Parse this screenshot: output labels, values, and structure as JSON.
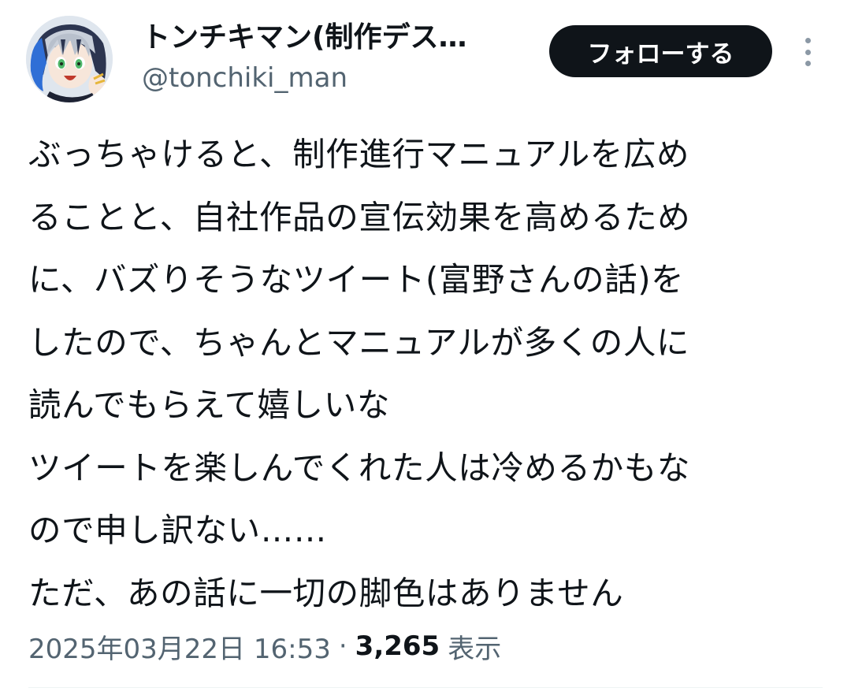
{
  "author": {
    "display_name": "トンチキマン(制作デス…",
    "handle": "@tonchiki_man"
  },
  "actions": {
    "follow_label": "フォローする"
  },
  "tweet": {
    "lines": [
      "ぶっちゃけると、制作進行マニュアルを広め",
      "ることと、自社作品の宣伝効果を高めるため",
      "に、バズりそうなツイート(富野さんの話)を",
      "したので、ちゃんとマニュアルが多くの人に",
      "読んでもらえて嬉しいな",
      "ツイートを楽しんでくれた人は冷めるかもな",
      "ので申し訳ない……",
      "ただ、あの話に一切の脚色はありません"
    ]
  },
  "meta": {
    "timestamp": "2025年03月22日 16:53",
    "separator": "·",
    "views_count": "3,265",
    "views_label": "表示"
  },
  "colors": {
    "text_primary": "#0f1419",
    "text_secondary": "#536471",
    "button_bg": "#0f1419",
    "button_text": "#ffffff"
  },
  "icons": {
    "more": "more-vertical-icon",
    "avatar": "anime-character-avatar"
  }
}
